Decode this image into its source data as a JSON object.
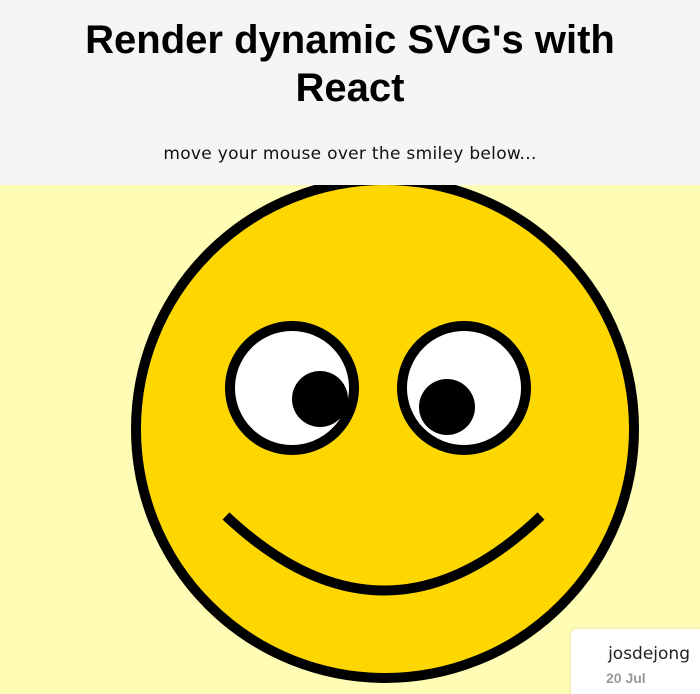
{
  "header": {
    "title_line1": "Render dynamic SVG's with",
    "title_line2": "React",
    "subtitle": "move your mouse over the smiley below..."
  },
  "author": {
    "name": "josdejong",
    "date": "20 Jul"
  },
  "colors": {
    "header_background": "#f5f5f5",
    "canvas_background": "#fffcb6",
    "face_fill": "#ffd700",
    "outline": "#000000",
    "eye_white": "#ffffff",
    "pupil": "#000000",
    "date_text": "#999999"
  }
}
